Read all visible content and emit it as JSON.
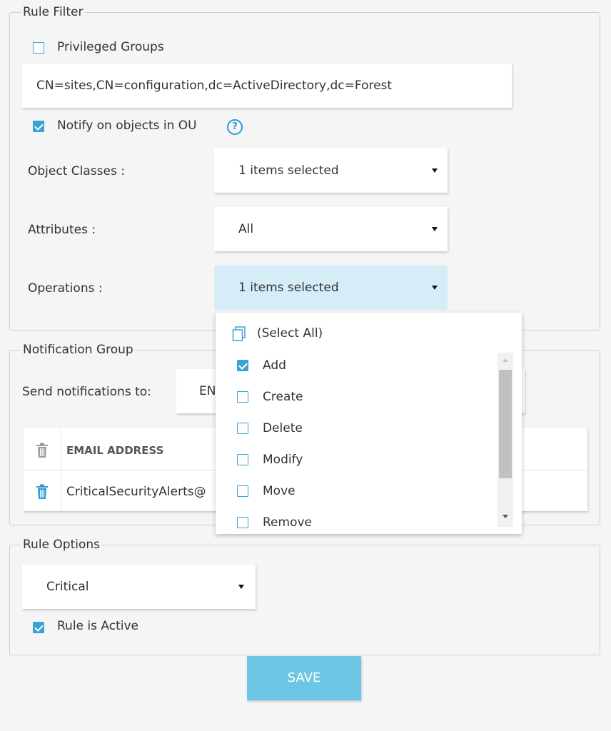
{
  "rule_filter": {
    "legend": "Rule Filter",
    "privileged_groups_label": "Privileged Groups",
    "privileged_groups_checked": false,
    "ou_path": "CN=sites,CN=configuration,dc=ActiveDirectory,dc=Forest",
    "notify_label": "Notify on objects in OU",
    "notify_checked": true,
    "help_glyph": "?",
    "object_classes_label": "Object Classes :",
    "object_classes_value": "1 items selected",
    "attributes_label": "Attributes :",
    "attributes_value": "All",
    "operations_label": "Operations :",
    "operations_value": "1 items selected"
  },
  "operations_dropdown": {
    "select_all_label": "(Select All)",
    "items": [
      {
        "label": "Add",
        "checked": true
      },
      {
        "label": "Create",
        "checked": false
      },
      {
        "label": "Delete",
        "checked": false
      },
      {
        "label": "Modify",
        "checked": false
      },
      {
        "label": "Move",
        "checked": false
      },
      {
        "label": "Remove",
        "checked": false
      }
    ]
  },
  "notification_group": {
    "legend": "Notification Group",
    "send_to_label": "Send notifications to:",
    "send_to_value": "EN",
    "table_header": "EMAIL ADDRESS",
    "rows": [
      {
        "email": "CriticalSecurityAlerts@"
      }
    ]
  },
  "rule_options": {
    "legend": "Rule Options",
    "severity_value": "Critical",
    "rule_active_label": "Rule is Active",
    "rule_active_checked": true
  },
  "save_label": "SAVE",
  "colors": {
    "accent": "#3aa3d3",
    "save_button": "#6ec6e6",
    "active_select": "#d6edf8"
  }
}
